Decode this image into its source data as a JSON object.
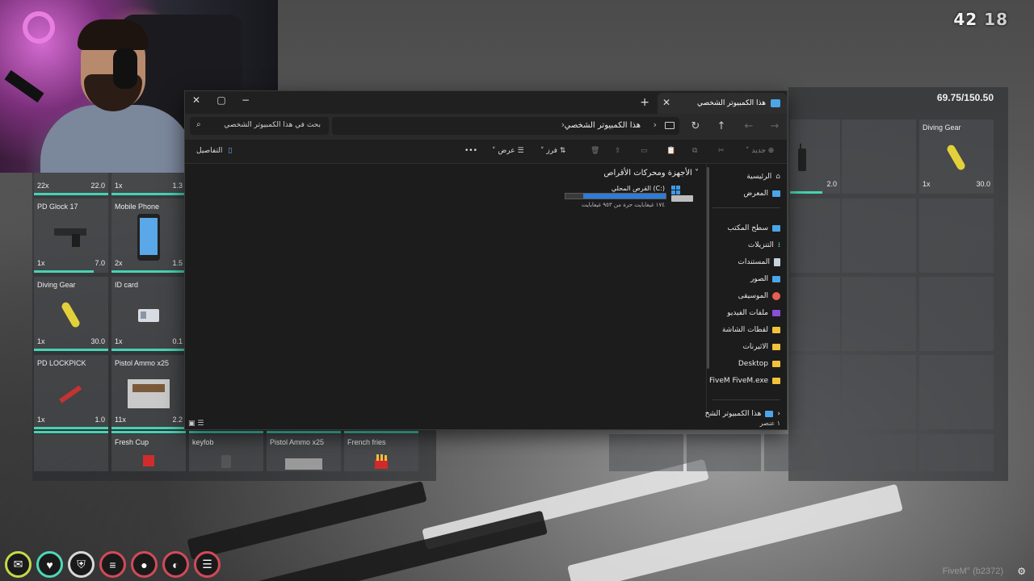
{
  "clock": {
    "hour": "42",
    "minute": "18"
  },
  "inventory": {
    "weight": "69.75/150.50",
    "top_row": [
      {
        "qty": "22x",
        "weight": "22.0"
      },
      {
        "qty": "1x",
        "weight": "1.3"
      }
    ],
    "left_slots": [
      {
        "name": "PD Glock 17",
        "qty": "1x",
        "weight": "7.0"
      },
      {
        "name": "Mobile Phone",
        "qty": "2x",
        "weight": "1.5"
      },
      {
        "name": "Diving Gear",
        "qty": "1x",
        "weight": "30.0"
      },
      {
        "name": "ID card",
        "qty": "1x",
        "weight": "0.1"
      },
      {
        "name": "PD LOCKPICK",
        "qty": "1x",
        "weight": "1.0"
      },
      {
        "name": "Pistol Ammo x25",
        "qty": "11x",
        "weight": "2.2"
      }
    ],
    "bottom_row": [
      {
        "name": ""
      },
      {
        "name": "Fresh Cup"
      },
      {
        "name": "keyfob"
      },
      {
        "name": "Pistol Ammo x25"
      },
      {
        "name": "French fries"
      }
    ],
    "right_slots": [
      {
        "name": "",
        "qty": "",
        "weight": "2.0"
      },
      {
        "name": "Diving Gear",
        "qty": "1x",
        "weight": "30.0"
      }
    ]
  },
  "explorer": {
    "tab_title": "هذا الكمبيوتر الشخصي",
    "breadcrumb": "هذا الكمبيوتر الشخصي",
    "search_placeholder": "بحث في هذا الكمبيوتر الشخصي",
    "toolbar": {
      "new": "جديد",
      "sort": "فرز",
      "view": "عرض",
      "more": "•••",
      "details": "التفاصيل"
    },
    "sidebar": {
      "home": "الرئيسية",
      "gallery": "المعرض",
      "desktop": "سطح المكتب",
      "downloads": "التنزيلات",
      "documents": "المستندات",
      "pictures": "الصور",
      "music": "الموسيقى",
      "videos": "ملفات الفيديو",
      "screenshots": "لقطات الشاشة",
      "series": "الاثيرنات",
      "desktop_en": "Desktop",
      "fivem": "FiveM FiveM.exe",
      "this_pc": "هذا الكمبيوتر الشخ"
    },
    "section_title": "الأجهزة ومحركات الأقراص",
    "drive": {
      "name": "القرص المحلي (C:)",
      "free_text": "١٧٤ غيغابايت حرة من ٩٥٣ غيغابايت",
      "used_fraction": 0.82
    },
    "status_count": "١ عنصر"
  },
  "hud": {
    "icons": [
      "chat-icon",
      "heart-icon",
      "shield-icon",
      "food-icon",
      "water-icon",
      "stamina-icon",
      "menu-icon"
    ]
  },
  "watermark": "FiveM° (b2372)",
  "colors": {
    "accent": "#46d3b4",
    "drive_bar": "#2f7bd8"
  }
}
